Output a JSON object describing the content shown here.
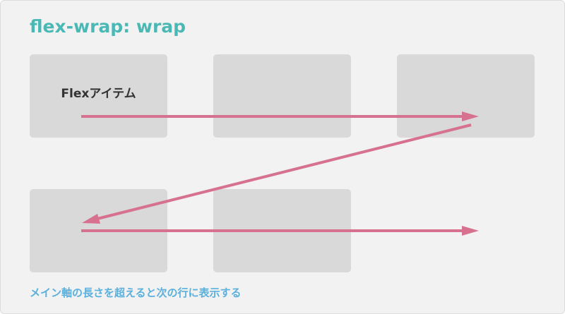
{
  "title": "flex-wrap: wrap",
  "item_label": "Flexアイテム",
  "caption": "メイン軸の長さを超えると次の行に表示する",
  "colors": {
    "title": "#4ab9b5",
    "caption": "#5bb0dc",
    "arrow": "#d6728f",
    "item": "#d9d9d9",
    "panel": "#f2f2f2"
  }
}
